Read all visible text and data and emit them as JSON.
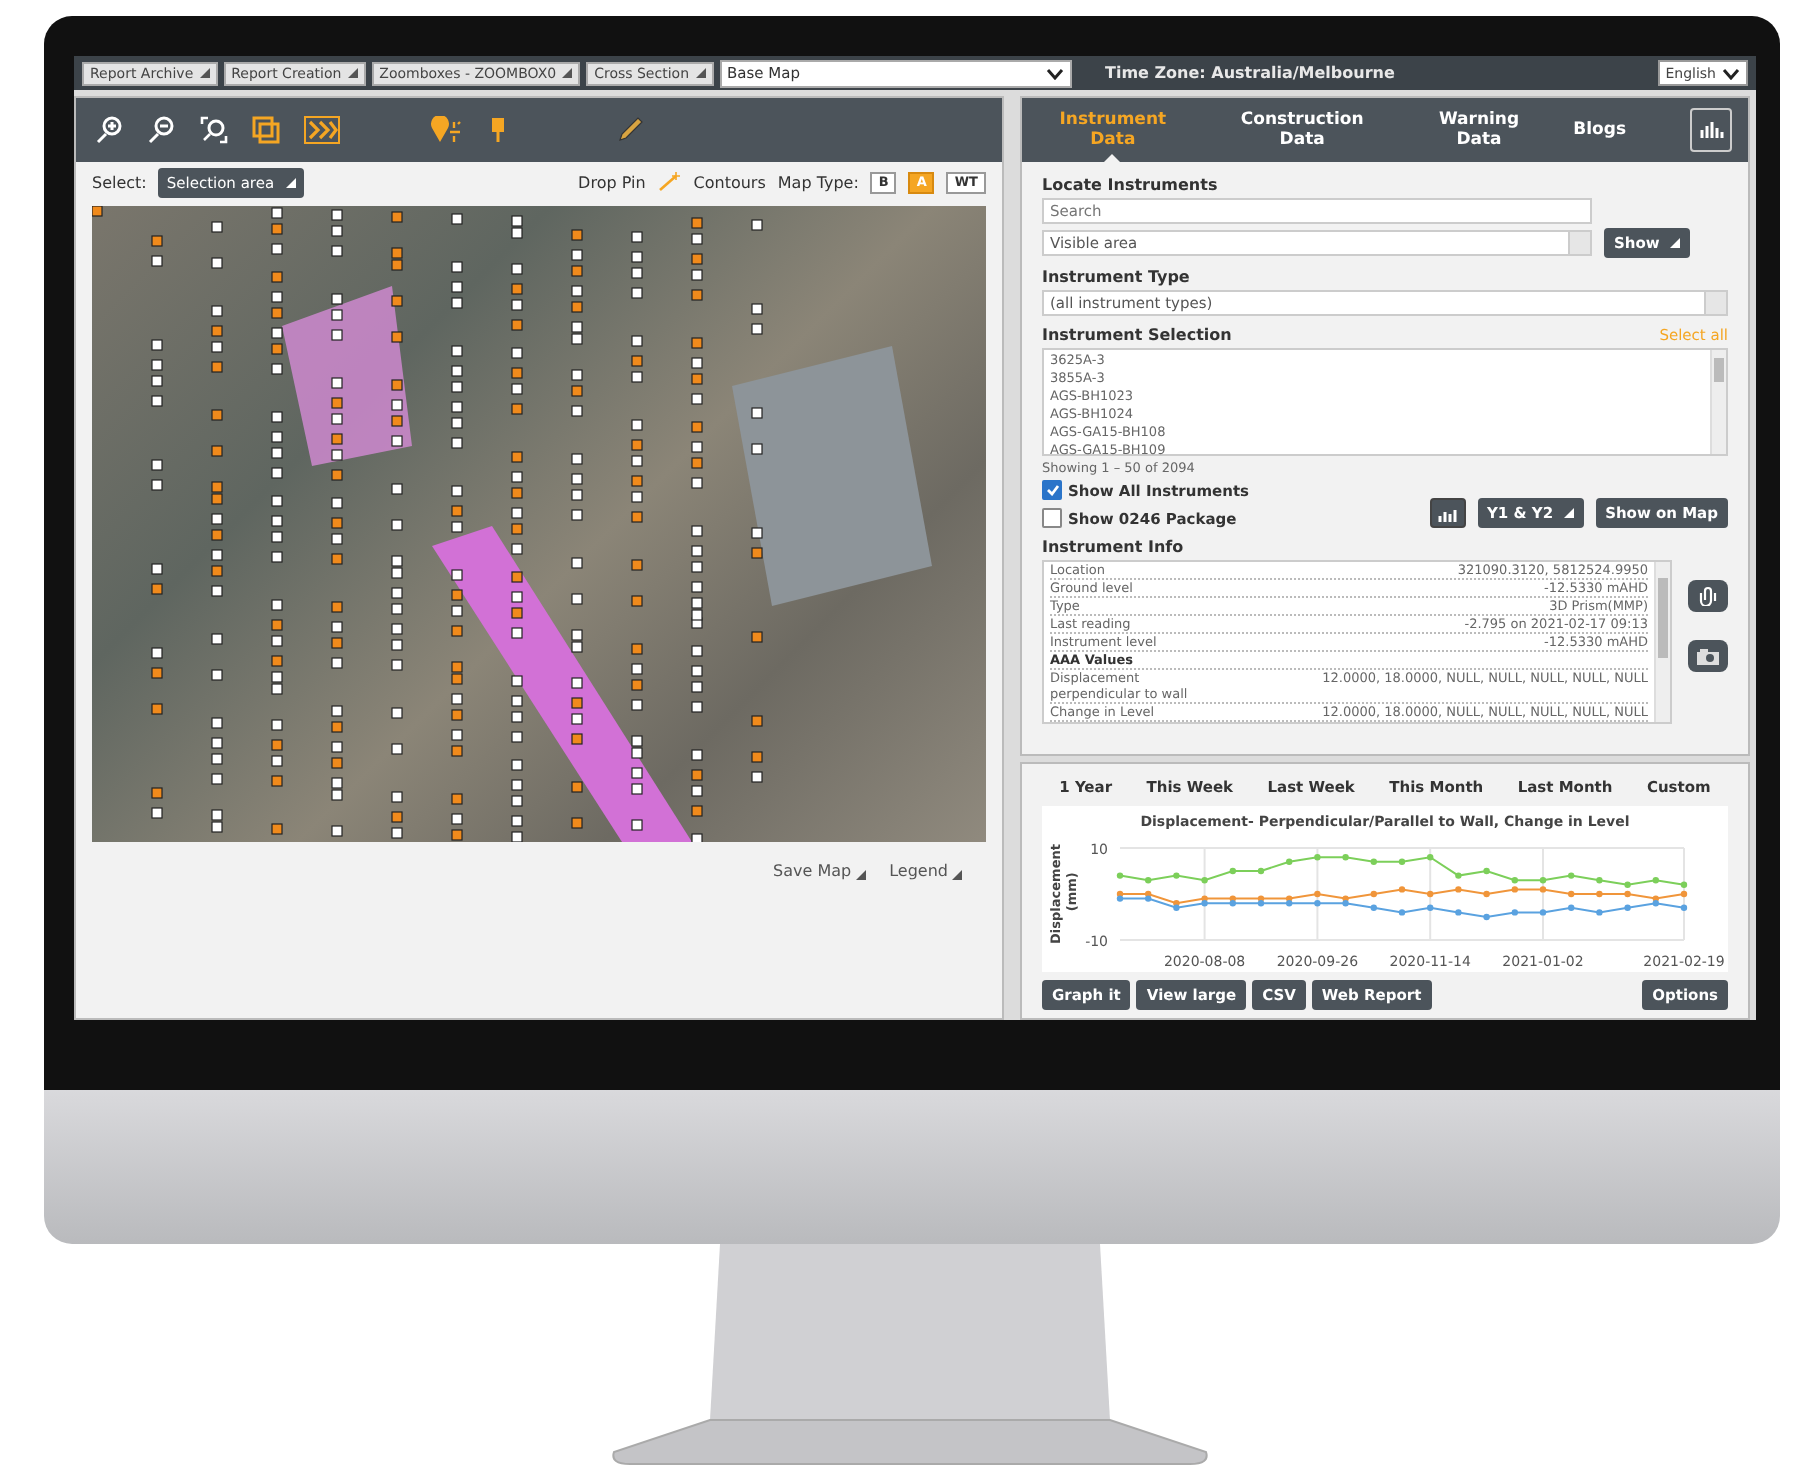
{
  "top_bar": {
    "menus": [
      {
        "label": "Report Archive"
      },
      {
        "label": "Report Creation"
      },
      {
        "label": "Zoomboxes - ZOOMBOX0"
      },
      {
        "label": "Cross Section"
      }
    ],
    "base_map": "Base Map",
    "time_zone": "Time Zone: Australia/Melbourne",
    "language": "English"
  },
  "map_panel": {
    "select_label": "Select:",
    "selection_mode": "Selection area",
    "drop_pin": "Drop Pin",
    "contours": "Contours",
    "map_type_label": "Map Type:",
    "map_types": [
      {
        "label": "B",
        "selected": false
      },
      {
        "label": "A",
        "selected": true
      },
      {
        "label": "WT",
        "selected": false
      }
    ],
    "footer_links": [
      "Save Map",
      "Legend"
    ]
  },
  "instrument_panel": {
    "tabs": [
      {
        "label": "Instrument Data",
        "selected": true
      },
      {
        "label": "Construction Data",
        "selected": false
      },
      {
        "label": "Warning Data",
        "selected": false
      },
      {
        "label": "Blogs",
        "selected": false
      }
    ],
    "locate_heading": "Locate Instruments",
    "search_placeholder": "Search",
    "area_value": "Visible area",
    "show_button": "Show",
    "type_heading": "Instrument Type",
    "type_value": "(all instrument types)",
    "selection_heading": "Instrument Selection",
    "select_all": "Select all",
    "instruments": [
      "3625A-3",
      "3855A-3",
      "AGS-BH1023",
      "AGS-BH1024",
      "AGS-GA15-BH108",
      "AGS-GA15-BH109"
    ],
    "showing": "Showing 1 – 50 of 2094",
    "checkboxes": [
      {
        "label": "Show All Instruments",
        "checked": true
      },
      {
        "label": "Show 0246 Package",
        "checked": false
      }
    ],
    "buttons": [
      "Y1 & Y2",
      "Show on Map"
    ],
    "info_heading": "Instrument Info",
    "info_rows": [
      {
        "kind": "row",
        "label": "Location",
        "value": "321090.3120, 5812524.9950"
      },
      {
        "kind": "row",
        "label": "Ground level",
        "value": "-12.5330 mAHD"
      },
      {
        "kind": "row",
        "label": "Type",
        "value": "3D Prism(MMP)"
      },
      {
        "kind": "row",
        "label": "Last reading",
        "value": "-2.795 on 2021-02-17 09:13"
      },
      {
        "kind": "row",
        "label": "Instrument level",
        "value": "-12.5330 mAHD"
      },
      {
        "kind": "section",
        "label": "AAA Values",
        "value": ""
      },
      {
        "kind": "row",
        "label": "Displacement perpendicular to wall",
        "value": "12.0000, 18.0000, NULL, NULL, NULL, NULL, NULL"
      },
      {
        "kind": "row",
        "label": "Change in Level",
        "value": "12.0000, 18.0000, NULL, NULL, NULL, NULL, NULL"
      }
    ]
  },
  "chart_panel": {
    "ranges": [
      "1 Year",
      "This Week",
      "Last Week",
      "This Month",
      "Last Month",
      "Custom"
    ],
    "chart_data": {
      "type": "line",
      "title": "Displacement- Perpendicular/Parallel to Wall, Change in Level",
      "ylabel": "Displacement (mm)",
      "categories": [
        null,
        null,
        null,
        "2020-08-08",
        null,
        null,
        null,
        "2020-09-26",
        null,
        null,
        null,
        "2020-11-14",
        null,
        null,
        null,
        "2021-01-02",
        null,
        null,
        null,
        null,
        "2021-02-19"
      ],
      "series": [
        {
          "color": "#7ccf5a",
          "marker": "circle",
          "values": [
            4,
            3,
            4,
            3,
            5,
            5,
            7,
            8,
            8,
            7,
            7,
            8,
            4,
            5,
            3,
            3,
            4,
            3,
            2,
            3,
            2
          ]
        },
        {
          "color": "#f0953a",
          "marker": "circle",
          "values": [
            0,
            0,
            -2,
            -1,
            -1,
            -1,
            -1,
            0,
            -1,
            0,
            1,
            0,
            1,
            0,
            1,
            1,
            0,
            0,
            0,
            -1,
            0
          ]
        },
        {
          "color": "#5aa2e0",
          "marker": "circle",
          "values": [
            -1,
            -1,
            -3,
            -2,
            -2,
            -2,
            -2,
            -2,
            -2,
            -3,
            -4,
            -3,
            -4,
            -5,
            -4,
            -4,
            -3,
            -4,
            -3,
            -2,
            -3
          ]
        }
      ],
      "ylim": [
        -10,
        10
      ],
      "yticks": [
        10,
        -10
      ],
      "grid": true
    },
    "buttons": [
      "Graph it",
      "View large",
      "CSV",
      "Web Report"
    ],
    "options_button": "Options"
  }
}
